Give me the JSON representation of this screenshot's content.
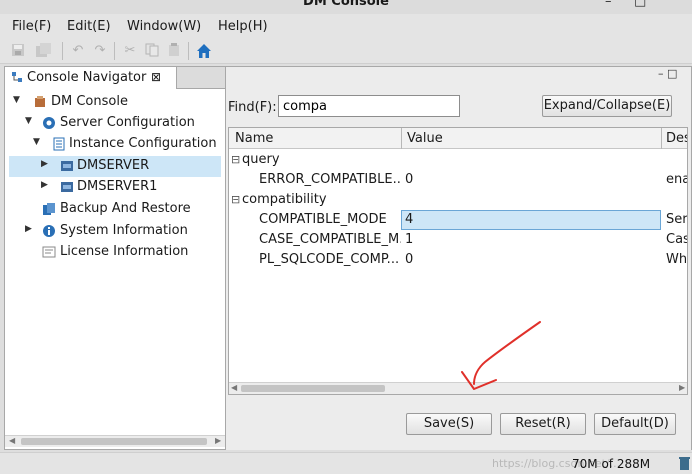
{
  "window": {
    "title": "DM Console",
    "minimize_glyph": "–",
    "close_glyph": "□"
  },
  "menu": [
    "File(F)",
    "Edit(E)",
    "Window(W)",
    "Help(H)"
  ],
  "toolbar": {
    "icons": [
      "save-icon",
      "save-all-icon",
      "undo-icon",
      "redo-icon",
      "cut-icon",
      "copy-icon",
      "paste-icon",
      "home-icon"
    ],
    "home_color": "#1f6fbf"
  },
  "navigator": {
    "tab_label": "Console Navigator",
    "tab_close": "⊠",
    "tree": [
      {
        "label": "DM Console",
        "icon": "dm-console-icon",
        "expanded": true,
        "selected": false
      },
      {
        "label": "Server Configuration",
        "icon": "gear-icon",
        "expanded": true,
        "selected": false
      },
      {
        "label": "Instance Configuration",
        "icon": "list-icon",
        "expanded": true,
        "selected": false
      },
      {
        "label": "DMSERVER",
        "icon": "server-icon",
        "expanded": false,
        "selected": true
      },
      {
        "label": "DMSERVER1",
        "icon": "server-icon",
        "expanded": false,
        "selected": false
      },
      {
        "label": "Backup And Restore",
        "icon": "backup-icon",
        "expanded": null,
        "selected": false
      },
      {
        "label": "System Information",
        "icon": "info-icon",
        "expanded": false,
        "selected": false
      },
      {
        "label": "License Information",
        "icon": "license-icon",
        "expanded": null,
        "selected": false
      }
    ]
  },
  "panel": {
    "view_controls": "–  □",
    "find_label": "Find(F):",
    "find_value": "compa",
    "expand_button": "Expand/Collapse(E)",
    "columns": [
      "Name",
      "Value",
      "Des"
    ],
    "groups": [
      {
        "name": "query",
        "toggle": "⊟",
        "rows": [
          {
            "name": "ERROR_COMPATIBLE...",
            "value": "0",
            "desc": "ena",
            "selected": false
          }
        ]
      },
      {
        "name": "compatibility",
        "toggle": "⊟",
        "rows": [
          {
            "name": "COMPATIBLE_MODE",
            "value": "4",
            "desc": "Ser",
            "selected": true
          },
          {
            "name": "CASE_COMPATIBLE_M...",
            "value": "1",
            "desc": "Cas",
            "selected": false
          },
          {
            "name": "PL_SQLCODE_COMP...",
            "value": "0",
            "desc": "Wh",
            "selected": false
          }
        ]
      }
    ],
    "save_button": "Save(S)",
    "reset_button": "Reset(R)",
    "default_button": "Default(D)"
  },
  "status": {
    "memory": "70M of 288M",
    "watermark": "https://blog.csdn.net/..."
  },
  "annotation": {
    "arrow_color": "#e0302a"
  }
}
